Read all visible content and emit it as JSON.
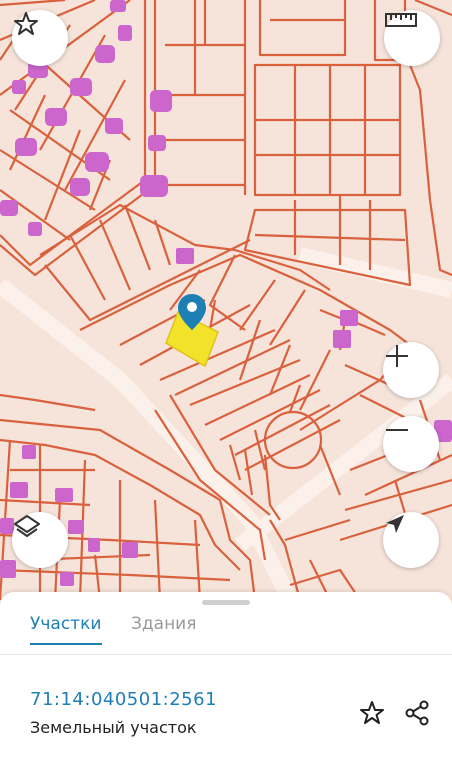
{
  "map": {
    "marker_icon": "location-pin-icon",
    "colors": {
      "background": "#f6e4da",
      "parcel_border": "#d9613d",
      "building": "#cc66cc",
      "selected_parcel": "#f2e32a",
      "marker": "#1e7fb5"
    }
  },
  "controls": {
    "favorite": "star-icon",
    "ruler": "ruler-icon",
    "zoom_in": "plus-icon",
    "zoom_out": "minus-icon",
    "layers": "layers-icon",
    "locate": "navigation-arrow-icon"
  },
  "sheet": {
    "tabs": [
      {
        "label": "Участки",
        "active": true
      },
      {
        "label": "Здания",
        "active": false
      }
    ],
    "cadastral_number": "71:14:040501:2561",
    "object_type": "Земельный участок",
    "actions": [
      "star-outline-icon",
      "share-icon"
    ]
  }
}
